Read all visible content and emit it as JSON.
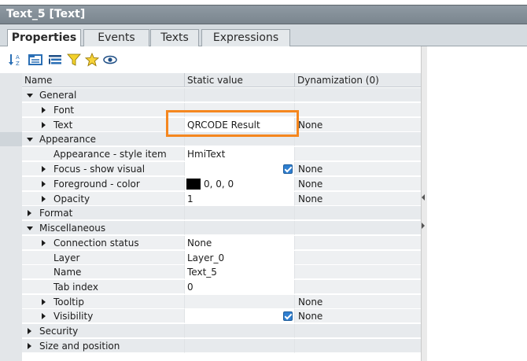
{
  "window": {
    "title": "Text_5 [Text]"
  },
  "tabs": [
    {
      "label": "Properties",
      "active": true
    },
    {
      "label": "Events",
      "active": false
    },
    {
      "label": "Texts",
      "active": false
    },
    {
      "label": "Expressions",
      "active": false
    }
  ],
  "toolbar": {
    "icons": [
      "sort-az-icon",
      "group-icon",
      "list-icon",
      "filter-icon",
      "favorite-icon",
      "view-icon"
    ]
  },
  "table": {
    "columns": {
      "name": "Name",
      "static": "Static value",
      "dyn": "Dynamization (0)"
    },
    "rows": [
      {
        "name": "General",
        "level": 0,
        "expand": "open",
        "static": "",
        "dyn": ""
      },
      {
        "name": "Font",
        "level": 1,
        "expand": "closed",
        "static": "",
        "dyn": ""
      },
      {
        "name": "Text",
        "level": 1,
        "expand": "closed",
        "static": "QRCODE Result",
        "dyn": "None"
      },
      {
        "name": "Appearance",
        "level": 0,
        "expand": "open",
        "static": "",
        "dyn": ""
      },
      {
        "name": "Appearance - style item",
        "level": 1,
        "expand": "none",
        "static": "HmiText",
        "dyn": ""
      },
      {
        "name": "Focus - show visual",
        "level": 1,
        "expand": "closed",
        "static": "",
        "check": true,
        "dyn": "None"
      },
      {
        "name": "Foreground - color",
        "level": 1,
        "expand": "closed",
        "static": "0, 0, 0",
        "color": "#000000",
        "dyn": "None"
      },
      {
        "name": "Opacity",
        "level": 1,
        "expand": "closed",
        "static": "1",
        "dyn": "None"
      },
      {
        "name": "Format",
        "level": 0,
        "expand": "closed",
        "static": "",
        "dyn": ""
      },
      {
        "name": "Miscellaneous",
        "level": 0,
        "expand": "open",
        "static": "",
        "dyn": ""
      },
      {
        "name": "Connection status",
        "level": 1,
        "expand": "closed",
        "static": "None",
        "dyn": ""
      },
      {
        "name": "Layer",
        "level": 1,
        "expand": "none",
        "static": "Layer_0",
        "dyn": ""
      },
      {
        "name": "Name",
        "level": 1,
        "expand": "none",
        "static": "Text_5",
        "dyn": ""
      },
      {
        "name": "Tab index",
        "level": 1,
        "expand": "none",
        "static": "0",
        "dyn": ""
      },
      {
        "name": "Tooltip",
        "level": 1,
        "expand": "closed",
        "static": "",
        "dyn": "None"
      },
      {
        "name": "Visibility",
        "level": 1,
        "expand": "closed",
        "static": "",
        "check": true,
        "dyn": "None"
      },
      {
        "name": "Security",
        "level": 0,
        "expand": "closed",
        "static": "",
        "dyn": ""
      },
      {
        "name": "Size and position",
        "level": 0,
        "expand": "closed",
        "static": "",
        "dyn": ""
      }
    ]
  },
  "colors": {
    "highlight": "#f5871f",
    "titlebar": "#7a858e",
    "checkbox": "#2f7fd0"
  }
}
